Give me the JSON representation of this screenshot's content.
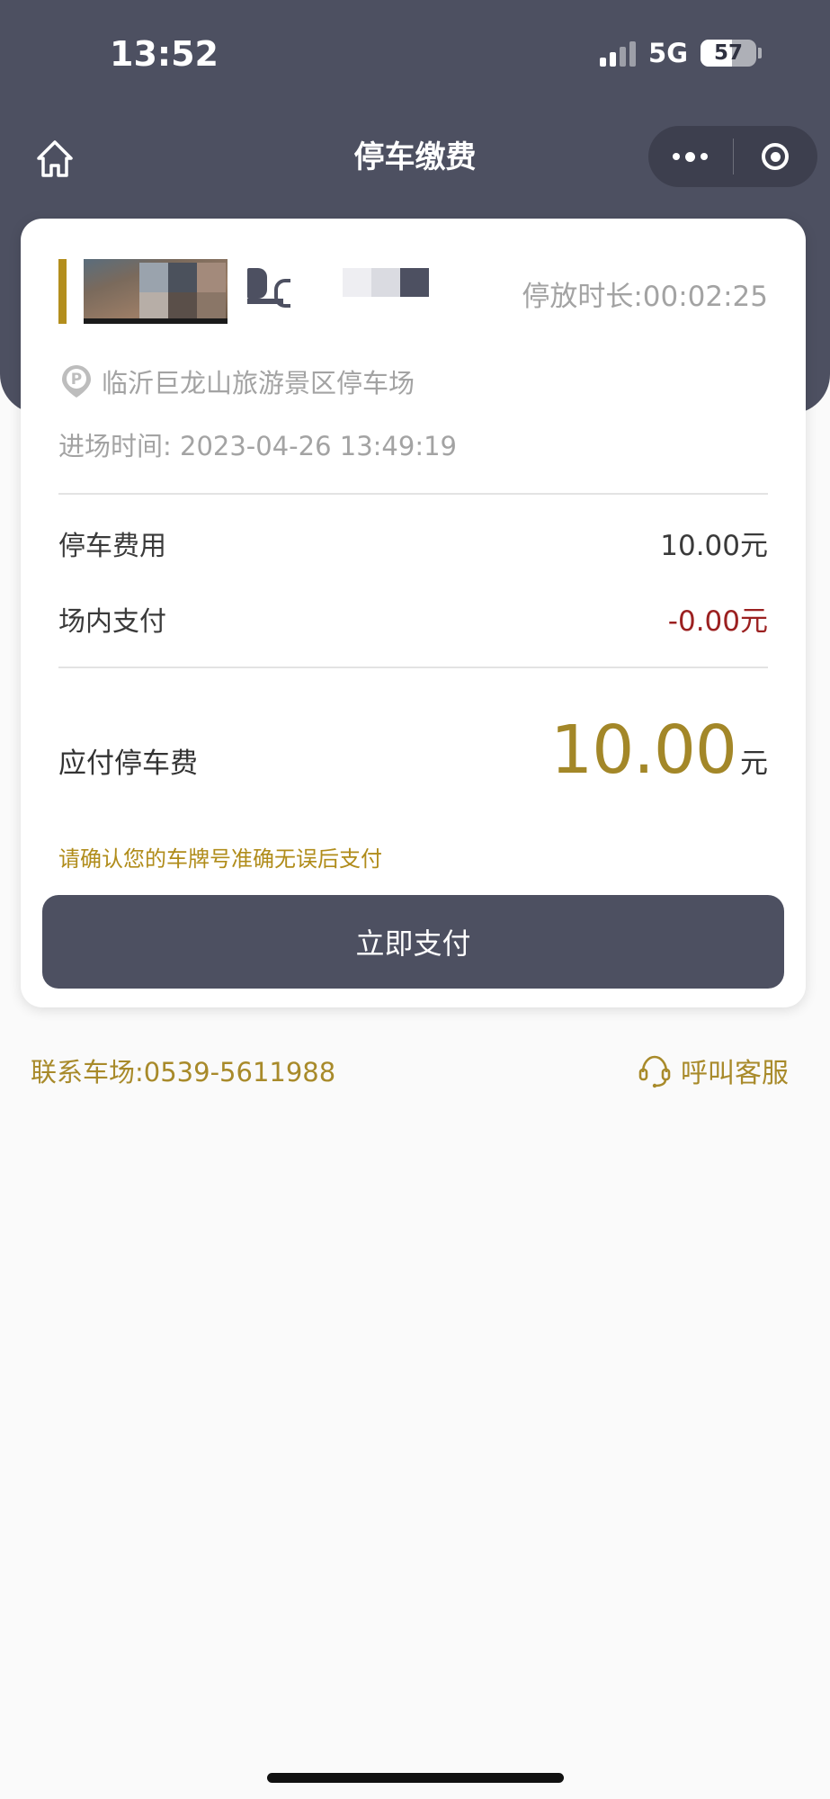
{
  "status_bar": {
    "time": "13:52",
    "network": "5G",
    "battery": "57",
    "battery_level": 0.57
  },
  "nav": {
    "title": "停车缴费"
  },
  "parking": {
    "duration": "停放时长:00:02:25",
    "lot_name": "临沂巨龙山旅游景区停车场",
    "entry_time": "进场时间: 2023-04-26 13:49:19"
  },
  "fees": {
    "parking_fee_label": "停车费用",
    "parking_fee_value": "10.00元",
    "onsite_paid_label": "场内支付",
    "onsite_paid_value": "-0.00元",
    "due_label": "应付停车费",
    "due_amount": "10.00",
    "due_unit": "元"
  },
  "warning": "请确认您的车牌号准确无误后支付",
  "pay_button": "立即支付",
  "footer": {
    "contact": "联系车场:0539-5611988",
    "service": "呼叫客服"
  },
  "colors": {
    "header": "#4d5061",
    "accent_gold": "#a38728",
    "negative_red": "#9b2020"
  },
  "icons": {
    "home": "home-icon",
    "more": "more-dots-icon",
    "close": "target-circle-icon",
    "parking": "parking-pin-icon",
    "headset": "headset-icon"
  }
}
